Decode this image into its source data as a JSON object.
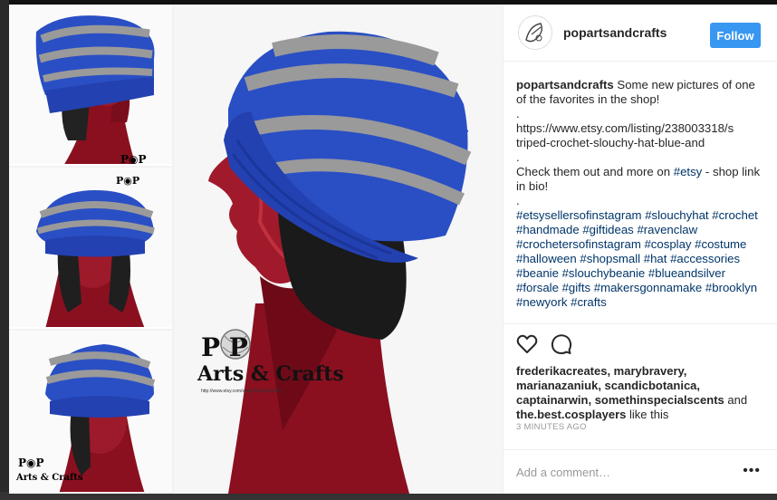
{
  "post": {
    "username": "popartsandcrafts",
    "follow_label": "Follow",
    "caption_lines": [
      "Some new pictures of one of the favorites in the shop!",
      ".",
      "https://www.etsy.com/listing/238003318/s",
      "triped-crochet-slouchy-hat-blue-and",
      ".",
      "Check them out and more on ",
      "#etsy",
      " - shop link in bio!",
      "."
    ],
    "hashtags": "#etsysellersofinstagram #slouchyhat #crochet #handmade #giftideas #ravenclaw #crochetersofinstagram #cosplay #costume #halloween #shopsmall #hat #accessories #beanie #slouchybeanie #blueandsilver #forsale #gifts #makersgonnamake #brooklyn #newyork #crafts",
    "likers": "frederikacreates, marybravery, marianazaniuk, scandicbotanica, captainarwin, somethinspecialscents",
    "likers_and": " and ",
    "last_liker": "the.best.cosplayers",
    "likes_suffix": " like this",
    "timestamp": "3 MINUTES AGO",
    "comment_placeholder": "Add a comment…",
    "more_label": "•••"
  },
  "photo": {
    "brand_top": "P  P",
    "brand_bottom": "Arts & Crafts",
    "brand_url": "http://www.etsy.com/shop/PopArtsCrafts"
  },
  "icons": {
    "like": "heart-icon",
    "comment": "comment-bubble-icon",
    "more": "more-options-icon"
  },
  "colors": {
    "follow_bg": "#3897f0",
    "hat_blue": "#2a4fc4",
    "hat_grey": "#9a9a9a",
    "mannequin_red": "#8a1020"
  }
}
